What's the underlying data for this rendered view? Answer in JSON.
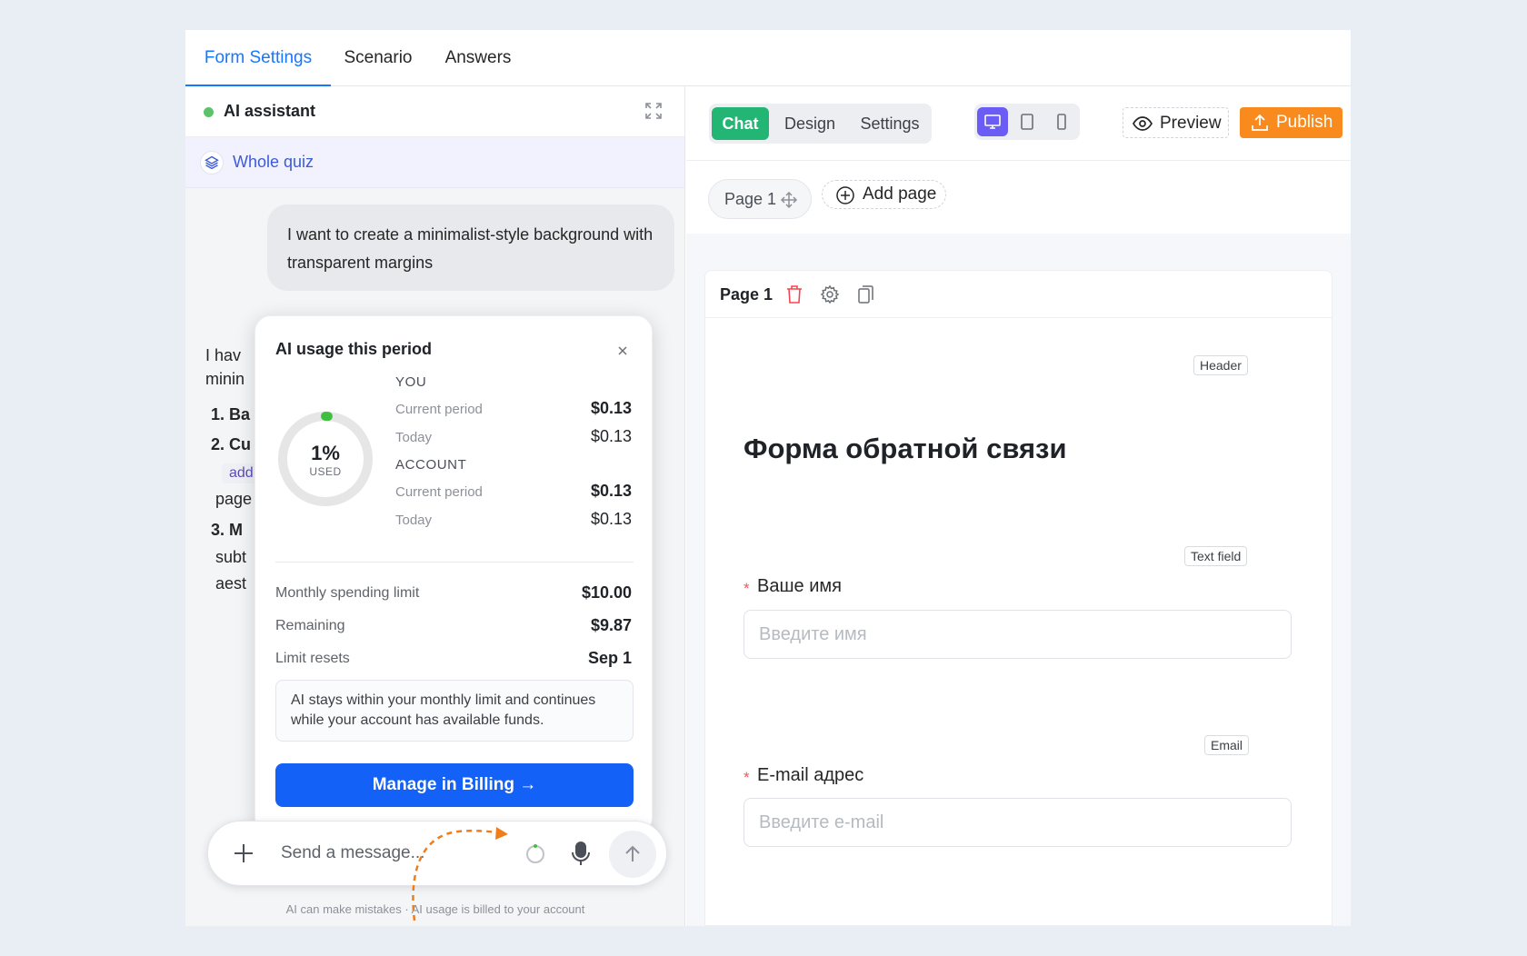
{
  "tabs": [
    {
      "label": "Form Settings",
      "active": true
    },
    {
      "label": "Scenario",
      "active": false
    },
    {
      "label": "Answers",
      "active": false
    }
  ],
  "assistant": {
    "title": "AI assistant",
    "scope_label": "Whole quiz",
    "user_message": "I want to create a minimalist-style background with transparent margins",
    "ai_lines": [
      "I hav",
      "minin",
      "1. Ba",
      "2. Cu",
      "page",
      "3. M",
      "subt",
      "aest"
    ],
    "ai_chip": "add",
    "composer_placeholder": "Send a message...",
    "disclaimer": "AI can make mistakes · AI usage is billed to your account"
  },
  "usage_popup": {
    "title": "AI usage this period",
    "percent_used": 1,
    "percent_label": "1%",
    "used_label": "USED",
    "you": {
      "label": "YOU",
      "current_period_label": "Current period",
      "current_period_value": "$0.13",
      "today_label": "Today",
      "today_value": "$0.13"
    },
    "account": {
      "label": "ACCOUNT",
      "current_period_label": "Current period",
      "current_period_value": "$0.13",
      "today_label": "Today",
      "today_value": "$0.13"
    },
    "monthly_limit_label": "Monthly spending limit",
    "monthly_limit_value": "$10.00",
    "remaining_label": "Remaining",
    "remaining_value": "$9.87",
    "resets_label": "Limit resets",
    "resets_value": "Sep 1",
    "info": "AI stays within your monthly limit and continues while your account has available funds.",
    "billing_button": "Manage in Billing →"
  },
  "toolbar": {
    "segments": [
      {
        "label": "Chat",
        "active": true
      },
      {
        "label": "Design",
        "active": false
      },
      {
        "label": "Settings",
        "active": false
      }
    ],
    "devices": [
      {
        "icon": "desktop-icon",
        "active": true
      },
      {
        "icon": "tablet-icon",
        "active": false
      },
      {
        "icon": "mobile-icon",
        "active": false
      }
    ],
    "preview_label": "Preview",
    "publish_label": "Publish"
  },
  "pages": {
    "current_page_label": "Page 1",
    "add_page_label": "Add page"
  },
  "canvas": {
    "page_title": "Page 1",
    "header_tag": "Header",
    "form_title": "Форма обратной связи",
    "fields": [
      {
        "tag": "Text field",
        "label": "Ваше имя",
        "placeholder": "Введите имя",
        "required": "*"
      },
      {
        "tag": "Email",
        "label": "E-mail адрес",
        "placeholder": "Введите e-mail",
        "required": "*"
      }
    ]
  },
  "colors": {
    "accent_blue": "#1677ff",
    "chat_green": "#22b573",
    "publish_orange": "#f98a1e",
    "billing_blue": "#1361f6",
    "device_active": "#6a5cf5",
    "donut_green": "#3fbf3f"
  }
}
